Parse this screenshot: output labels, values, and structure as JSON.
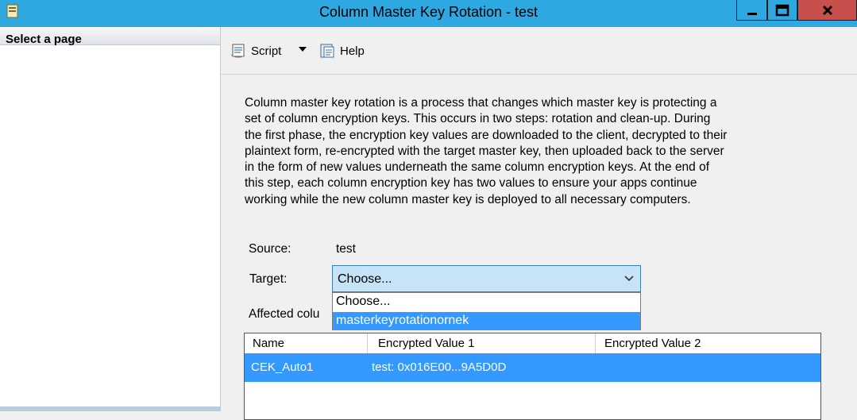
{
  "window": {
    "title": "Column Master Key Rotation - test",
    "minimize_label": "_",
    "maximize_label": "☐",
    "close_label": "X"
  },
  "left_pane": {
    "header": "Select a page"
  },
  "toolbar": {
    "script_label": "Script",
    "help_label": "Help",
    "script_icon": "script-icon",
    "help_icon": "help-icon"
  },
  "content": {
    "description_lines": [
      "Column master key rotation is a process that changes which master key is protecting a",
      "set of column encryption keys. This occurs in two steps: rotation and clean-up. During",
      "the first phase, the encryption key values are downloaded to the client, decrypted to their",
      "plaintext form, re-encrypted with the target master key, then uploaded back to the server",
      "in the form of new values underneath the same column encryption keys. At the end of",
      "this step, each column encryption key has two values to ensure your apps continue",
      "working while the new column master key is deployed to all necessary computers."
    ],
    "source_label": "Source:",
    "source_value": "test",
    "target_label": "Target:",
    "target_selected": "Choose...",
    "target_options": [
      "Choose...",
      "masterkeyrotationornek"
    ],
    "affected_label": "Affected colu"
  },
  "grid": {
    "columns": [
      "Name",
      "Encrypted Value 1",
      "Encrypted Value 2"
    ],
    "rows": [
      {
        "name": "CEK_Auto1",
        "value1": "test: 0x016E00...9A5D0D",
        "value2": ""
      }
    ]
  },
  "colors": {
    "titlebar": "#2ea8e0",
    "close_button": "#c7504c",
    "selection": "#3399ff",
    "combo_bg": "#c6e3f7"
  }
}
